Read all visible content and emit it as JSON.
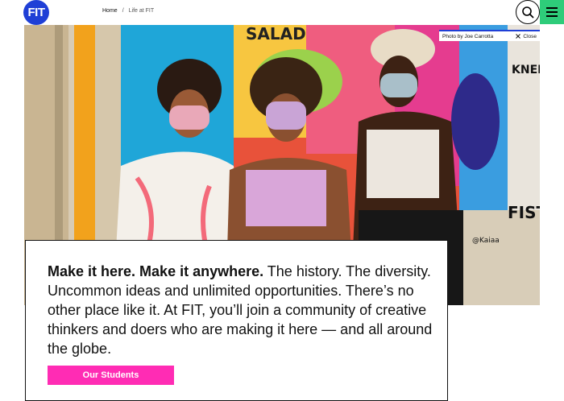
{
  "header": {
    "logo_text": "FIT",
    "breadcrumb": {
      "home": "Home",
      "separator": "/",
      "current": "Life at FIT"
    }
  },
  "hero": {
    "photo_credit": "Photo by Joe Carrotta",
    "close_label": "Close",
    "mural_text": [
      "SALAD",
      "KNEE",
      "FIST",
      "@Kaiaa"
    ]
  },
  "card": {
    "headline": "Make it here. Make it anywhere.",
    "body": " The history. The diversity. Uncommon ideas and unlimited opportunities. There’s no other place like it. At FIT, you’ll join a community of creative thinkers and doers who are making it here — and all around the globe.",
    "button_label": "Our Students"
  },
  "colors": {
    "brand_blue": "#1f3fd6",
    "menu_green": "#2ecc7a",
    "cta_pink": "#ff2cb4"
  },
  "icons": [
    "search-icon",
    "menu-icon",
    "close-icon"
  ]
}
